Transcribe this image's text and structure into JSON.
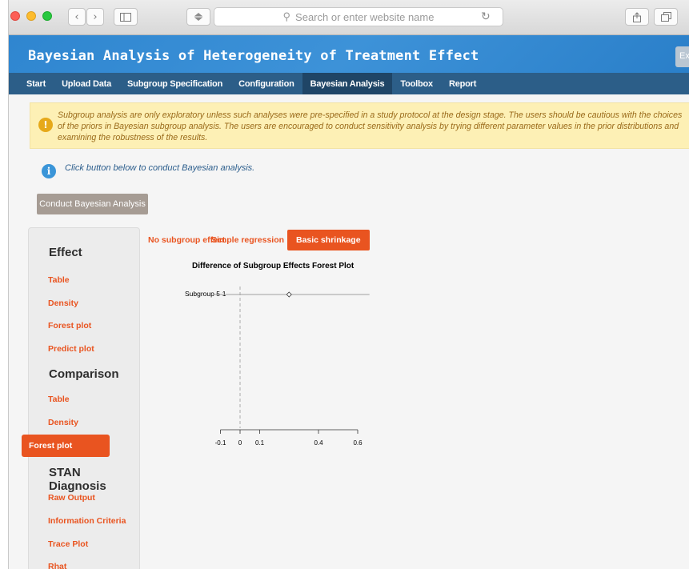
{
  "browser": {
    "url_placeholder": "Search or enter website name",
    "icons": [
      "back-icon",
      "forward-icon",
      "sidebar-icon",
      "share-icon",
      "tabs-icon",
      "reload-icon",
      "search-icon"
    ]
  },
  "app": {
    "title": "Bayesian Analysis of Heterogeneity of Treatment Effect",
    "exit_label": "Exit"
  },
  "nav": {
    "items": [
      "Start",
      "Upload Data",
      "Subgroup Specification",
      "Configuration",
      "Bayesian Analysis",
      "Toolbox",
      "Report"
    ],
    "active": "Bayesian Analysis"
  },
  "alerts": {
    "warning": "Subgroup analysis are only exploratory unless such analyses were pre-specified in a study protocol at the design stage. The users should be cautious with the choices of the priors in Bayesian subgroup analysis. The users are encouraged to conduct sensitivity analysis by trying different parameter values in the prior distributions and examining the robustness of the results.",
    "info": "Click button below to conduct Bayesian analysis."
  },
  "conduct_button": "Conduct Bayesian Analysis",
  "sidebar": {
    "sections": [
      {
        "title": "Effect",
        "items": [
          "Table",
          "Density",
          "Forest plot",
          "Predict plot"
        ]
      },
      {
        "title": "Comparison",
        "items": [
          "Table",
          "Density",
          "Forest plot"
        ]
      },
      {
        "title": "STAN Diagnosis",
        "items": [
          "Raw Output",
          "Information Criteria",
          "Trace Plot",
          "Rhat"
        ]
      }
    ],
    "active": "Comparison / Forest plot"
  },
  "tabs": {
    "items": [
      "No subgroup effect",
      "Simple regression",
      "Basic shrinkage"
    ],
    "active": "Basic shrinkage"
  },
  "colors": {
    "accent": "#e95420",
    "nav_bg": "#2c5e88",
    "header_bg": "#3a8fd6",
    "warning_bg": "#fdf0b5",
    "warning_text": "#9a6a1a"
  },
  "chart_data": {
    "type": "forest",
    "title": "Difference of Subgroup Effects Forest Plot",
    "categories": [
      "Subgroup 5-1"
    ],
    "estimate": [
      0.25
    ],
    "lower": [
      -0.14
    ],
    "upper": [
      0.66
    ],
    "reference_line": 0,
    "xticks": [
      -0.1,
      0,
      0.1,
      0.4,
      0.6
    ],
    "xtick_labels": [
      "-0.1",
      "0",
      "0.1",
      "0.4",
      "0.6"
    ],
    "xlim": [
      -0.1,
      0.6
    ]
  }
}
